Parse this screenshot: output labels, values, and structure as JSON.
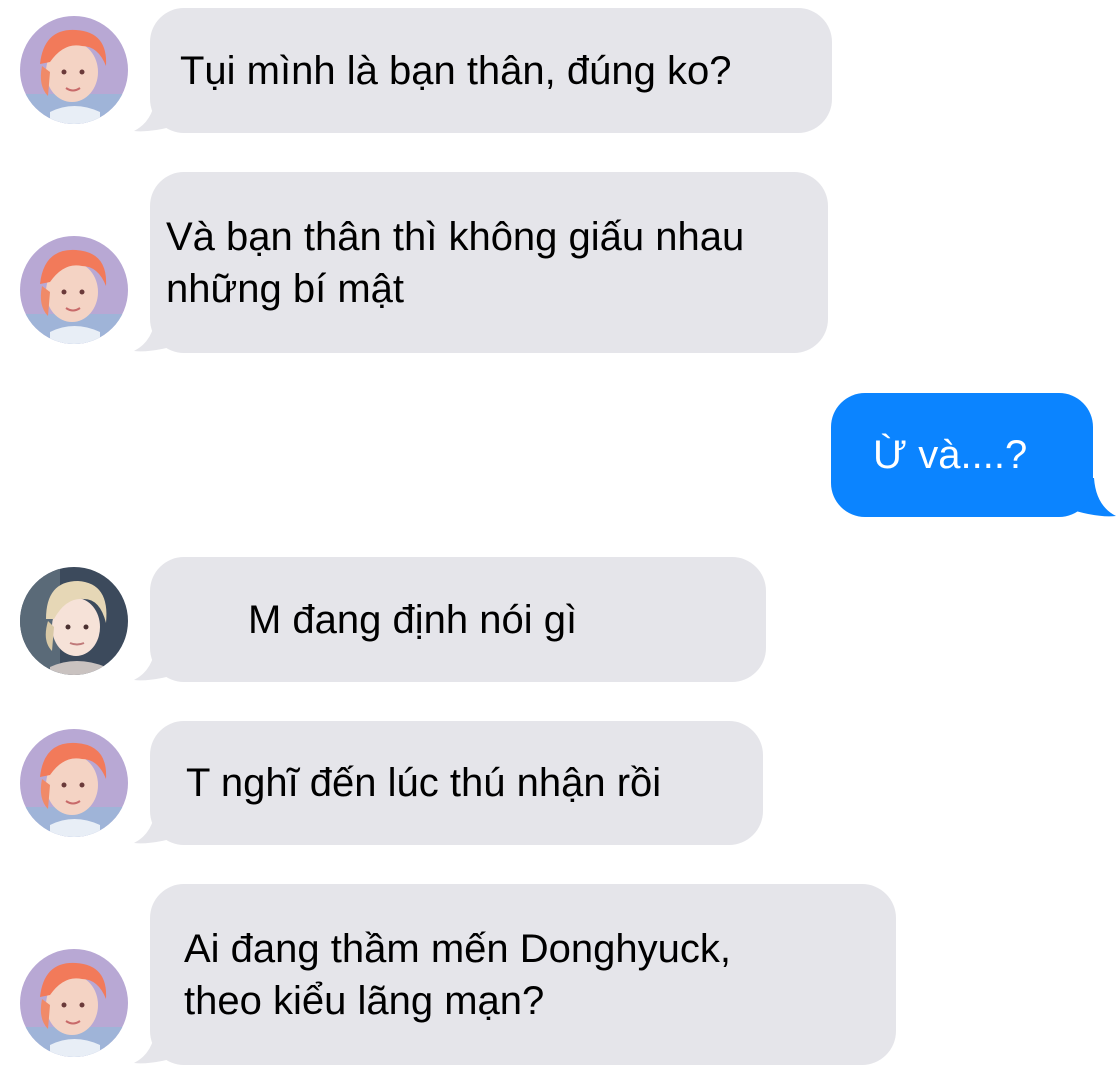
{
  "colors": {
    "incoming_bubble": "#e5e5ea",
    "outgoing_bubble": "#0b84ff",
    "incoming_text": "#000000",
    "outgoing_text": "#ffffff"
  },
  "messages": [
    {
      "sender": "friend",
      "avatar": "orange-haired-avatar-icon",
      "text": "Tụi mình là bạn thân, đúng ko?"
    },
    {
      "sender": "friend",
      "avatar": "orange-haired-avatar-icon",
      "text": "Và bạn thân thì không giấu nhau\nnhững bí mật"
    },
    {
      "sender": "me",
      "avatar": null,
      "text": "Ừ và....?"
    },
    {
      "sender": "other",
      "avatar": "blond-haired-avatar-icon",
      "text": "M đang định nói gì"
    },
    {
      "sender": "friend",
      "avatar": "orange-haired-avatar-icon",
      "text": "T nghĩ đến lúc thú nhận rồi"
    },
    {
      "sender": "friend",
      "avatar": "orange-haired-avatar-icon",
      "text": "Ai đang thầm mến Donghyuck,\ntheo kiểu lãng mạn?"
    }
  ]
}
